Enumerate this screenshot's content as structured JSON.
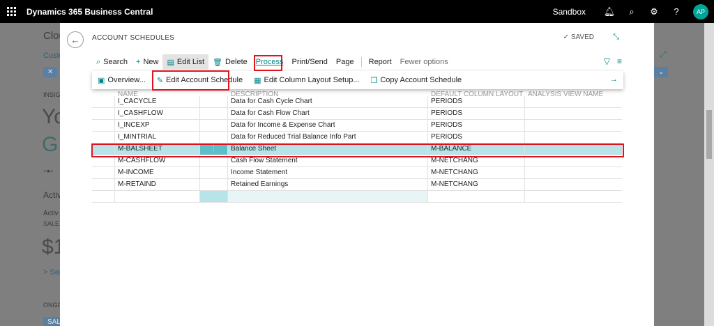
{
  "topbar": {
    "app_title": "Dynamics 365 Business Central",
    "environment": "Sandbox",
    "icons": [
      "bell-icon",
      "search-icon",
      "gear-icon",
      "help-icon"
    ],
    "avatar_initials": "AP"
  },
  "background_page": {
    "caption": "Clou",
    "link": "Custo",
    "insight_label": "INSIG",
    "headline_1": "Yo",
    "headline_2": "G",
    "dots": "○●○",
    "activities": "Activ",
    "activities_sub": "Activ",
    "sales_label": "SALE",
    "amount": "$1",
    "see_more": "> See",
    "ongoing": "ONGO",
    "sales_chip": "SAL"
  },
  "dialog": {
    "page_caption": "ACCOUNT SCHEDULES",
    "saved_text": "SAVED",
    "actions": [
      {
        "label": "Search",
        "icon": "search-icon"
      },
      {
        "label": "New",
        "icon": "plus-icon"
      },
      {
        "label": "Edit List",
        "icon": "edit-list-icon"
      },
      {
        "label": "Delete",
        "icon": "trash-icon"
      },
      {
        "label": "Process"
      },
      {
        "label": "Print/Send"
      },
      {
        "label": "Page"
      },
      {
        "label": "Report"
      },
      {
        "label": "Fewer options"
      }
    ],
    "subactions": [
      {
        "label": "Overview...",
        "icon": "overview-icon"
      },
      {
        "label": "Edit Account Schedule",
        "icon": "pencil-icon"
      },
      {
        "label": "Edit Column Layout Setup...",
        "icon": "column-layout-icon"
      },
      {
        "label": "Copy Account Schedule",
        "icon": "copy-icon"
      }
    ],
    "columns": [
      "NAME",
      "DESCRIPTION",
      "DEFAULT COLUMN LAYOUT",
      "ANALYSIS VIEW NAME"
    ],
    "rows": [
      {
        "name": "I_CACYCLE",
        "description": "Data for Cash Cycle Chart",
        "layout": "PERIODS",
        "view": ""
      },
      {
        "name": "I_CASHFLOW",
        "description": "Data for Cash Flow Chart",
        "layout": "PERIODS",
        "view": ""
      },
      {
        "name": "I_INCEXP",
        "description": "Data for Income & Expense Chart",
        "layout": "PERIODS",
        "view": ""
      },
      {
        "name": "I_MINTRIAL",
        "description": "Data for Reduced Trial Balance Info Part",
        "layout": "PERIODS",
        "view": ""
      },
      {
        "name": "M-BALSHEET",
        "description": "Balance Sheet",
        "layout": "M-BALANCE",
        "view": ""
      },
      {
        "name": "M-CASHFLOW",
        "description": "Cash Flow Statement",
        "layout": "M-NETCHANG",
        "view": ""
      },
      {
        "name": "M-INCOME",
        "description": "Income Statement",
        "layout": "M-NETCHANG",
        "view": ""
      },
      {
        "name": "M-RETAIND",
        "description": "Retained Earnings",
        "layout": "M-NETCHANG",
        "view": ""
      }
    ],
    "row_menu_glyph": "⋮"
  },
  "colors": {
    "accent": "#008489",
    "selected_row": "#b6e4e8",
    "highlight_box": "#e0141e"
  }
}
